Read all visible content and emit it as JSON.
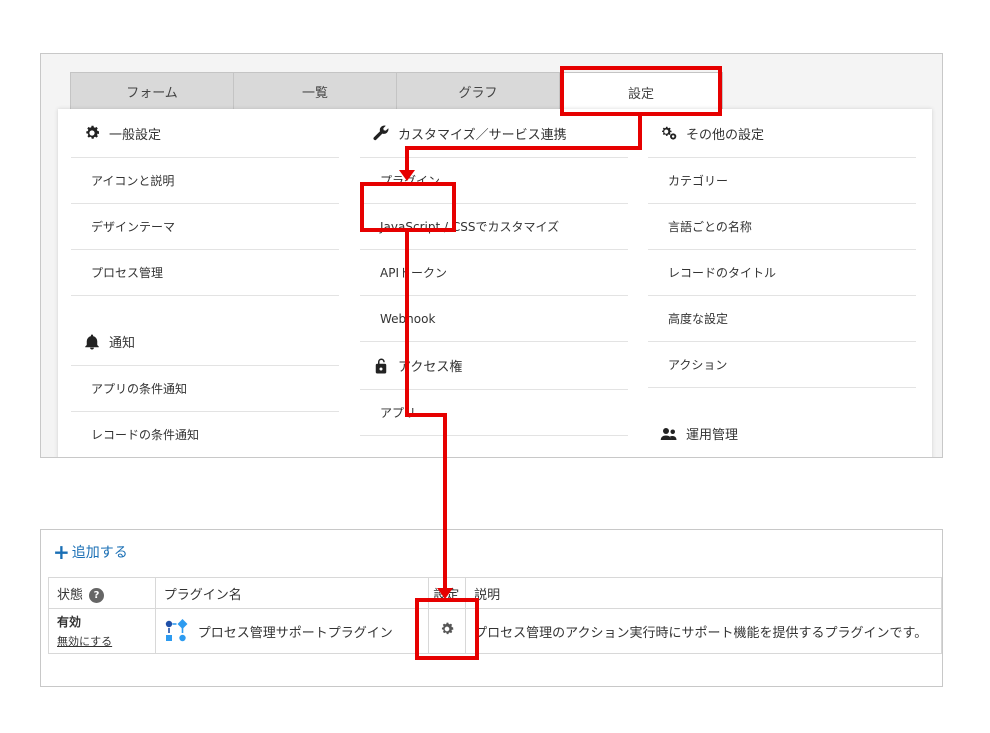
{
  "tabs": [
    {
      "label": "フォーム"
    },
    {
      "label": "一覧"
    },
    {
      "label": "グラフ"
    },
    {
      "label": "設定"
    }
  ],
  "general": {
    "title": "一般設定",
    "items": [
      "アイコンと説明",
      "デザインテーマ",
      "プロセス管理"
    ]
  },
  "notify": {
    "title": "通知",
    "items": [
      "アプリの条件通知",
      "レコードの条件通知"
    ]
  },
  "customize": {
    "title": "カスタマイズ／サービス連携",
    "items": [
      "プラグイン",
      "JavaScript / CSSでカスタマイズ",
      "APIトークン",
      "Webhook"
    ]
  },
  "access": {
    "title": "アクセス権",
    "items": [
      "アプリ"
    ]
  },
  "other": {
    "title": "その他の設定",
    "items": [
      "カテゴリー",
      "言語ごとの名称",
      "レコードのタイトル",
      "高度な設定",
      "アクション"
    ]
  },
  "operation": {
    "title": "運用管理"
  },
  "plugins": {
    "add_label": "追加する",
    "headers": {
      "status": "状態",
      "name": "プラグイン名",
      "settings": "設定",
      "desc": "説明"
    },
    "help_glyph": "?",
    "rows": [
      {
        "status": "有効",
        "action": "無効にする",
        "name": "プロセス管理サポートプラグイン",
        "desc": "プロセス管理のアクション実行時にサポート機能を提供するプラグインです。"
      }
    ]
  },
  "colors": {
    "annotation": "#e60000",
    "link": "#1a6fb5",
    "plugin_icon": "#2d9bf0"
  }
}
